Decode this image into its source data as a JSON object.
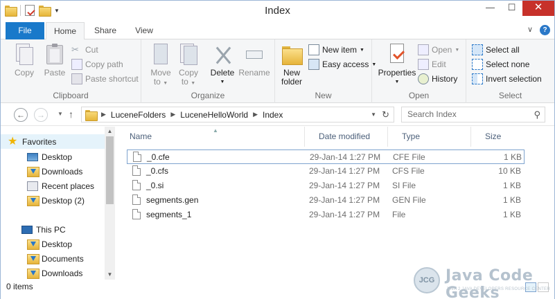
{
  "window": {
    "title": "Index"
  },
  "window_controls": {
    "minimize": "—",
    "maximize": "☐",
    "close": "✕"
  },
  "ribbon_tabs": {
    "file": "File",
    "home": "Home",
    "share": "Share",
    "view": "View"
  },
  "ribbon": {
    "clipboard": {
      "label": "Clipboard",
      "copy": "Copy",
      "paste": "Paste",
      "cut": "Cut",
      "copy_path": "Copy path",
      "paste_shortcut": "Paste shortcut"
    },
    "organize": {
      "label": "Organize",
      "move_to_1": "Move",
      "move_to_2": "to",
      "copy_to_1": "Copy",
      "copy_to_2": "to",
      "delete": "Delete",
      "rename": "Rename"
    },
    "new": {
      "label": "New",
      "new_folder_1": "New",
      "new_folder_2": "folder",
      "new_item": "New item",
      "easy_access": "Easy access"
    },
    "open": {
      "label": "Open",
      "properties": "Properties",
      "open": "Open",
      "edit": "Edit",
      "history": "History"
    },
    "select": {
      "label": "Select",
      "select_all": "Select all",
      "select_none": "Select none",
      "invert_selection": "Invert selection"
    }
  },
  "address": {
    "crumbs": [
      "LuceneFolders",
      "LuceneHelloWorld",
      "Index"
    ]
  },
  "search": {
    "placeholder": "Search Index"
  },
  "nav_pane": {
    "favorites": "Favorites",
    "desktop": "Desktop",
    "downloads": "Downloads",
    "recent_places": "Recent places",
    "desktop2": "Desktop (2)",
    "this_pc": "This PC",
    "pc_desktop": "Desktop",
    "pc_documents": "Documents",
    "pc_downloads": "Downloads"
  },
  "columns": {
    "name": "Name",
    "date_modified": "Date modified",
    "type": "Type",
    "size": "Size"
  },
  "files": [
    {
      "name": "_0.cfe",
      "date": "29-Jan-14 1:27 PM",
      "type": "CFE File",
      "size": "1 KB"
    },
    {
      "name": "_0.cfs",
      "date": "29-Jan-14 1:27 PM",
      "type": "CFS File",
      "size": "10 KB"
    },
    {
      "name": "_0.si",
      "date": "29-Jan-14 1:27 PM",
      "type": "SI File",
      "size": "1 KB"
    },
    {
      "name": "segments.gen",
      "date": "29-Jan-14 1:27 PM",
      "type": "GEN File",
      "size": "1 KB"
    },
    {
      "name": "segments_1",
      "date": "29-Jan-14 1:27 PM",
      "type": "File",
      "size": "1 KB"
    }
  ],
  "status": {
    "items": "0 items"
  },
  "watermark": {
    "brand": "Java Code Geeks",
    "tagline": "JAVA 2 JAVA DEVELOPERS RESOURCE CENTER",
    "logo": "JCG"
  }
}
